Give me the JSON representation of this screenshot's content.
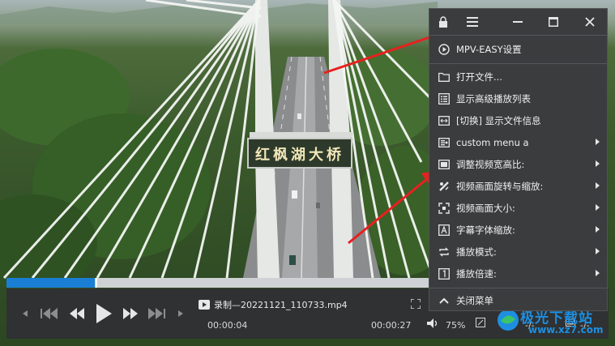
{
  "video": {
    "bridge_sign": "红枫湖大桥"
  },
  "player": {
    "progress_fraction": 0.21,
    "file_title": "录制—20221121_110733.mp4",
    "time_current": "00:00:04",
    "time_total": "00:00:27",
    "volume": "75%",
    "left_dash": "-/-",
    "right_dash": "-/-"
  },
  "menu": {
    "settings_label": "MPV-EASY设置",
    "items": [
      {
        "label": "打开文件...",
        "icon": "folder-icon",
        "submenu": false
      },
      {
        "label": "显示高级播放列表",
        "icon": "list-icon",
        "submenu": false
      },
      {
        "label": "[切换] 显示文件信息",
        "icon": "info-icon",
        "submenu": false
      },
      {
        "label": "custom menu a",
        "icon": "custom-icon",
        "submenu": true
      },
      {
        "label": "调整视频宽高比:",
        "icon": "aspect-icon",
        "submenu": true
      },
      {
        "label": "视频画面旋转与缩放:",
        "icon": "rotate-icon",
        "submenu": true
      },
      {
        "label": "视频画面大小:",
        "icon": "resize-icon",
        "submenu": true
      },
      {
        "label": "字幕字体缩放:",
        "icon": "font-icon",
        "submenu": true
      },
      {
        "label": "播放模式:",
        "icon": "loop-icon",
        "submenu": true
      },
      {
        "label": "播放倍速:",
        "icon": "speed-icon",
        "submenu": true
      }
    ],
    "close_label": "关闭菜单"
  },
  "watermark": {
    "line1": "极光下载站",
    "line2": "www.xz7.com"
  },
  "colors": {
    "accent": "#1a7fd4",
    "menu_bg": "#3a3c3e",
    "annotation_arrow": "#e8201f"
  }
}
